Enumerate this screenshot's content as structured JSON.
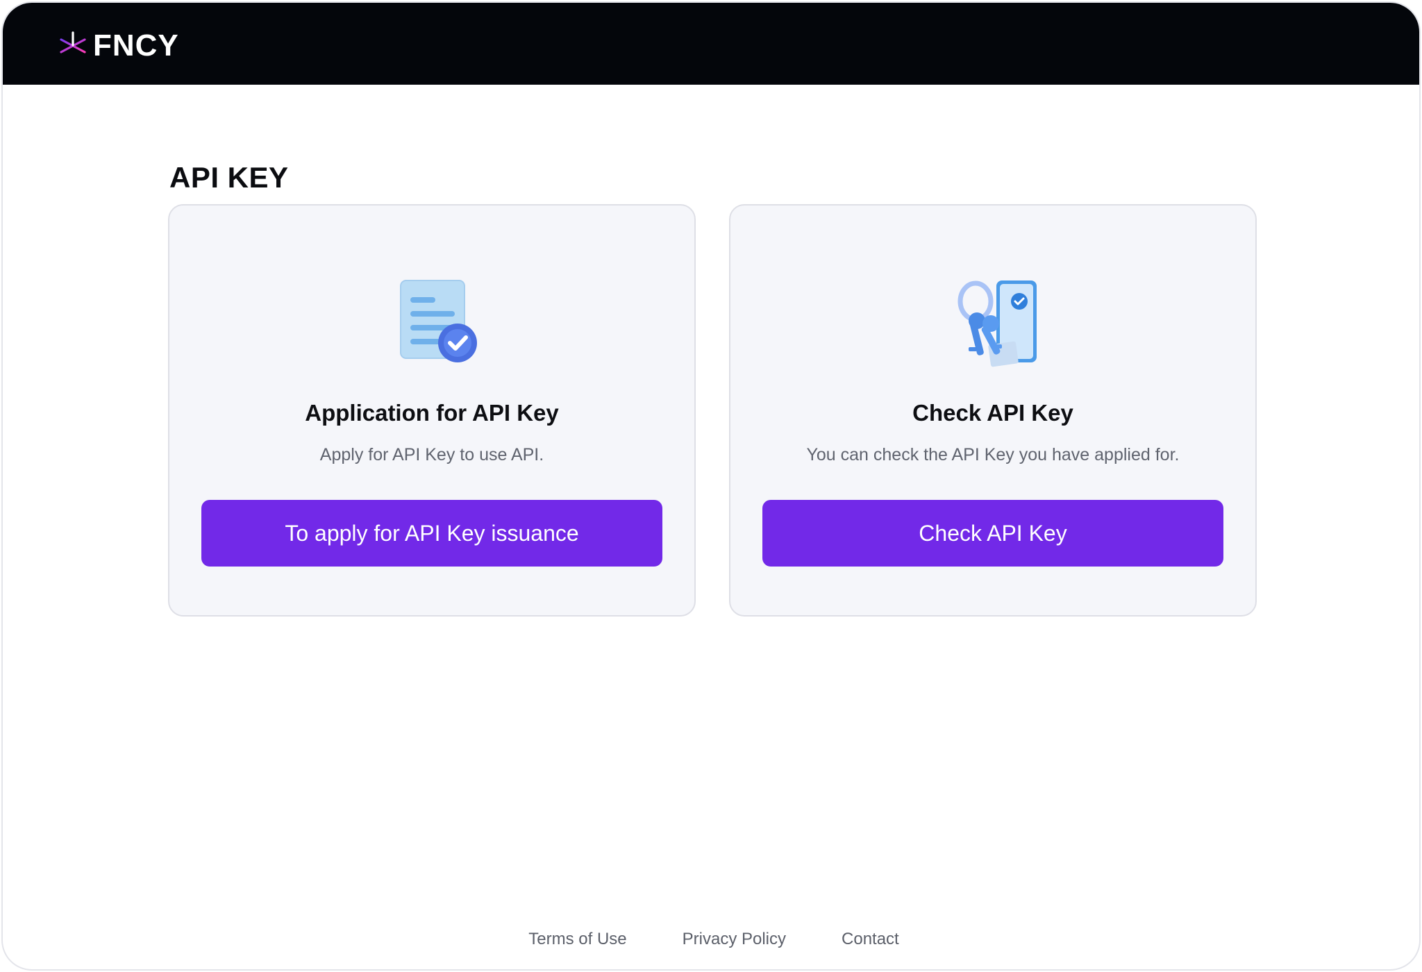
{
  "header": {
    "brand": "FNCY",
    "logo_icon": "fncy-asterisk-logo-icon",
    "brand_colors": {
      "gradient_start": "#7b3cf0",
      "gradient_end": "#ff3db8"
    }
  },
  "main": {
    "title": "API KEY",
    "cards": [
      {
        "icon": "document-check-icon",
        "title": "Application for API Key",
        "description": "Apply for API Key to use API.",
        "button_label": "To apply for API Key issuance"
      },
      {
        "icon": "keys-phone-icon",
        "title": "Check API Key",
        "description": "You can check the API Key you have applied for.",
        "button_label": "Check API Key"
      }
    ]
  },
  "footer": {
    "links": [
      "Terms of Use",
      "Privacy Policy",
      "Contact"
    ]
  },
  "colors": {
    "accent": "#7229e8",
    "header_bg": "#04060b",
    "card_bg": "#f5f6fa"
  }
}
